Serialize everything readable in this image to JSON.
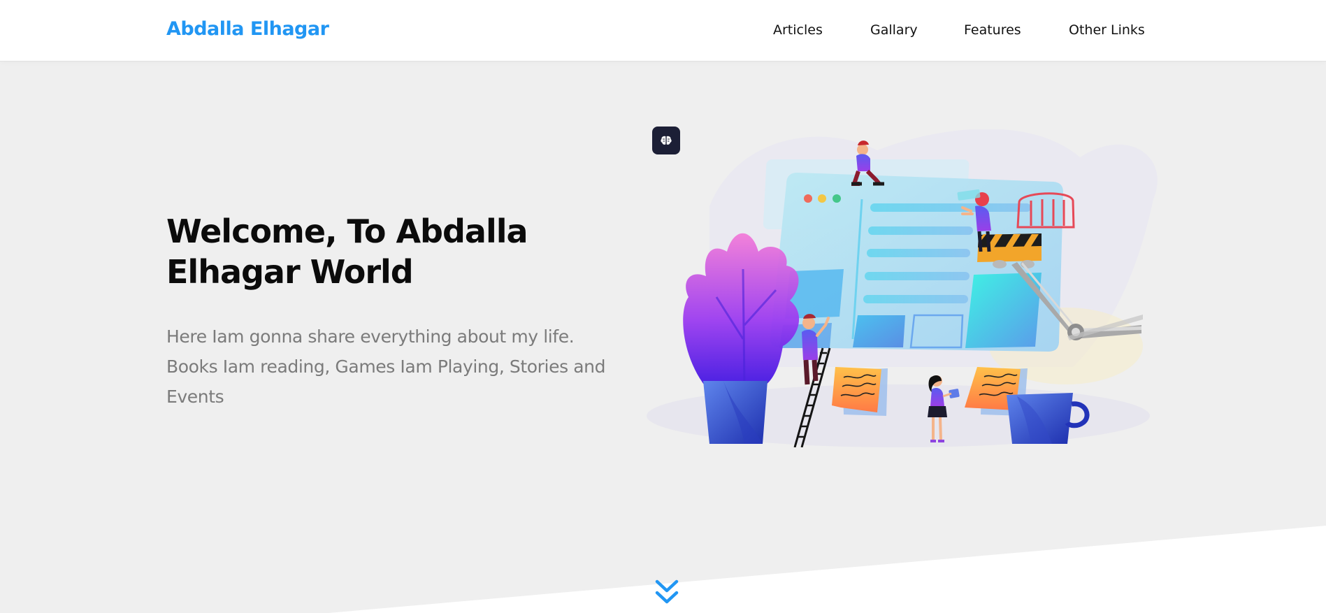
{
  "header": {
    "logo": "Abdalla Elhagar",
    "nav": [
      {
        "label": "Articles"
      },
      {
        "label": "Gallary"
      },
      {
        "label": "Features"
      },
      {
        "label": "Other Links"
      }
    ]
  },
  "hero": {
    "title": "Welcome, To Abdalla Elhagar World",
    "text": "Here Iam gonna share everything about my life. Books Iam reading, Games Iam Playing, Stories and Events"
  },
  "icons": {
    "badge": "brain-icon",
    "scroll": "chevron-double-down-icon"
  },
  "colors": {
    "accent": "#2196f3",
    "background": "#efefef",
    "header_bg": "#ffffff",
    "title": "#0b0b0b",
    "text": "#7b7b7b",
    "badge_bg": "#1c1f36"
  }
}
